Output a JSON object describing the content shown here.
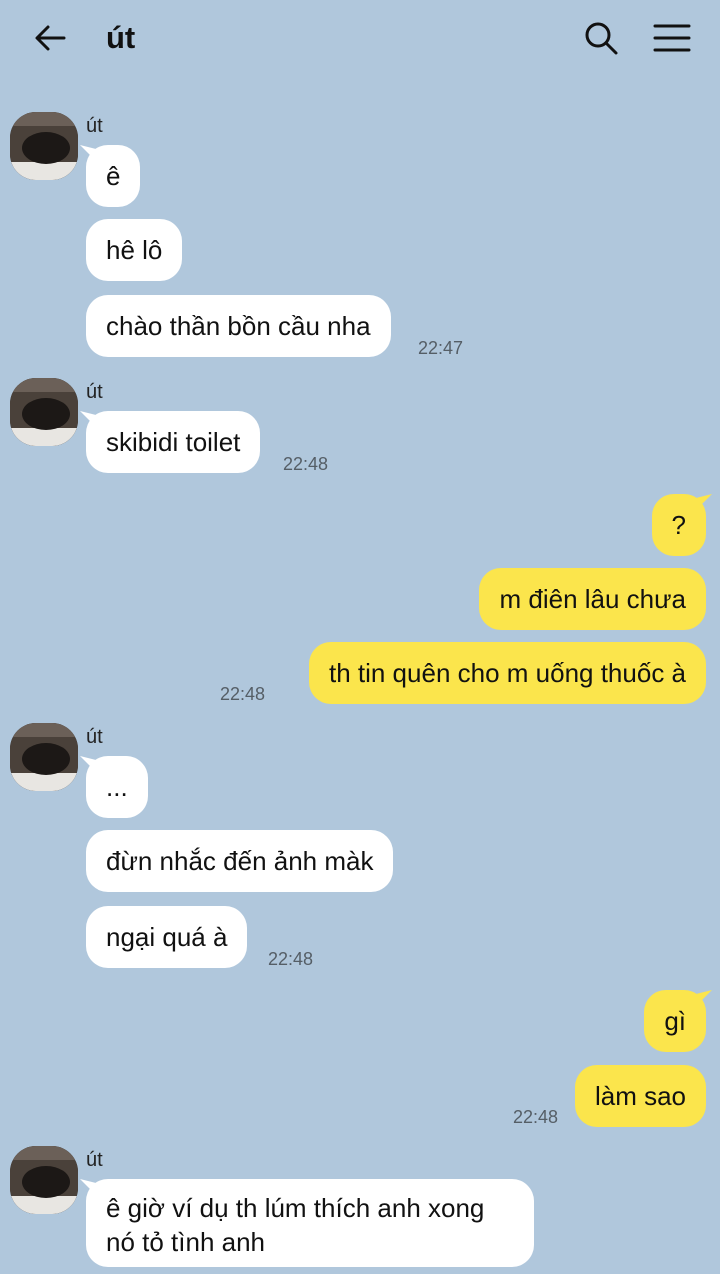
{
  "header": {
    "title": "út",
    "back_icon": "arrow-left-icon",
    "search_icon": "search-icon",
    "menu_icon": "hamburger-menu-icon"
  },
  "colors": {
    "background": "#b0c7dc",
    "incoming_bubble": "#ffffff",
    "outgoing_bubble": "#fbe54c"
  },
  "groups": [
    {
      "sender": "út",
      "messages": [
        "ê",
        "hê lô",
        "chào thần bồn cầu nha"
      ],
      "time": "22:47"
    },
    {
      "sender": "út",
      "messages": [
        "skibidi toilet"
      ],
      "time": "22:48"
    },
    {
      "sender": "me",
      "messages": [
        "?",
        "m điên lâu chưa",
        "th tin quên cho m uống thuốc à"
      ],
      "time": "22:48"
    },
    {
      "sender": "út",
      "messages": [
        "...",
        "đừn nhắc đến ảnh màk",
        "ngại quá à"
      ],
      "time": "22:48"
    },
    {
      "sender": "me",
      "messages": [
        "gì",
        "làm sao"
      ],
      "time": "22:48"
    },
    {
      "sender": "út",
      "messages": [
        "ê giờ ví dụ th lúm thích anh xong nó tỏ tình anh"
      ],
      "time": ""
    }
  ]
}
